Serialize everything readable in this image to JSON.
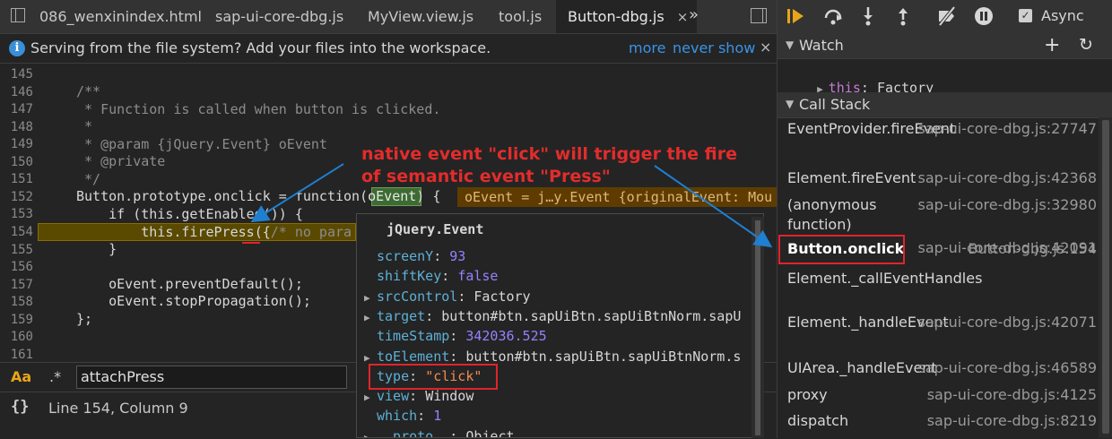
{
  "tabs": [
    {
      "label": "086_wenxinindex.html",
      "active": false,
      "closable": false
    },
    {
      "label": "sap-ui-core-dbg.js",
      "active": false,
      "closable": false
    },
    {
      "label": "MyView.view.js",
      "active": false,
      "closable": false
    },
    {
      "label": "tool.js",
      "active": false,
      "closable": false
    },
    {
      "label": "Button-dbg.js",
      "active": true,
      "closable": true
    }
  ],
  "tab_overflow": "»",
  "tab_close_glyph": "×",
  "info_bar": {
    "message": "Serving from the file system? Add your files into the workspace.",
    "link_more": "more",
    "link_never": "never show",
    "close": "×",
    "icon": "i"
  },
  "code": {
    "line_numbers": [
      "145",
      "146",
      "147",
      "148",
      "149",
      "150",
      "151",
      "152",
      "153",
      "154",
      "155",
      "156",
      "157",
      "158",
      "159",
      "160",
      "161"
    ],
    "line_146": "/**",
    "line_147": " * Function is called when button is clicked.",
    "line_148": " *",
    "line_149": " * @param {jQuery.Event} oEvent",
    "line_150": " * @private",
    "line_151": " */",
    "line_152_a": "Button.prototype.onclick = function(",
    "line_152_param": "oEvent",
    "line_152_b": ") {",
    "line_152_inline": "oEvent = j…y.Event {originalEvent: Mou",
    "line_153": "    if (this.getEnabled()) {",
    "line_154_a": "        this.",
    "line_154_fn": "firePress",
    "line_154_b": "({",
    "line_154_cmt": "/* no para",
    "line_155": "    }",
    "line_157": "    oEvent.preventDefault();",
    "line_158": "    oEvent.stopPropagation();",
    "line_159": "};"
  },
  "search": {
    "case_label": "Aa",
    "regex_label": ".*",
    "value": "attachPress"
  },
  "status": {
    "braces": "{}",
    "position": "Line 154, Column 9"
  },
  "popover": {
    "title": "jQuery.Event",
    "rows": [
      {
        "expand": "",
        "key": "screenY",
        "sep": ": ",
        "value": "93",
        "kind": "num"
      },
      {
        "expand": "",
        "key": "shiftKey",
        "sep": ": ",
        "value": "false",
        "kind": "kw"
      },
      {
        "expand": "▶",
        "key": "srcControl",
        "sep": ": ",
        "value": "Factory",
        "kind": "obj"
      },
      {
        "expand": "▶",
        "key": "target",
        "sep": ": ",
        "value": "button#btn.sapUiBtn.sapUiBtnNorm.sapU",
        "kind": "obj"
      },
      {
        "expand": "",
        "key": "timeStamp",
        "sep": ": ",
        "value": "342036.525",
        "kind": "num"
      },
      {
        "expand": "▶",
        "key": "toElement",
        "sep": ": ",
        "value": "button#btn.sapUiBtn.sapUiBtnNorm.s",
        "kind": "obj"
      },
      {
        "expand": "",
        "key": "type",
        "sep": ": ",
        "value": "\"click\"",
        "kind": "str"
      },
      {
        "expand": "▶",
        "key": "view",
        "sep": ": ",
        "value": "Window",
        "kind": "obj"
      },
      {
        "expand": "",
        "key": "which",
        "sep": ": ",
        "value": "1",
        "kind": "num"
      },
      {
        "expand": "▶",
        "key": "__proto__",
        "sep": ": ",
        "value": "Object",
        "kind": "obj"
      }
    ]
  },
  "annotation": {
    "line1": "native event \"click\" will trigger the fire",
    "line2": "of semantic event \"Press\"",
    "color": "#e32c2c"
  },
  "debugger": {
    "async_label": "Async",
    "async_checked": true,
    "watch_title": "Watch",
    "watch_add": "+",
    "watch_refresh": "↻",
    "watch_key": "this",
    "watch_value": "Factory",
    "call_stack_title": "Call Stack",
    "frames": [
      {
        "name": "EventProvider.fireEvent",
        "location": "sap-ui-core-dbg.js:27747",
        "selected": false
      },
      {
        "name": "Element.fireEvent",
        "location": "sap-ui-core-dbg.js:42368",
        "selected": false
      },
      {
        "name": "(anonymous function)",
        "location": "sap-ui-core-dbg.js:32980",
        "selected": false
      },
      {
        "name": "Button.onclick",
        "location": "Button-dbg.js:154",
        "selected": true
      },
      {
        "name": "Element._callEventHandles",
        "location": "sap-ui-core-dbg.js:42091",
        "selected": false
      },
      {
        "name": "Element._handleEvent",
        "location": "sap-ui-core-dbg.js:42071",
        "selected": false
      },
      {
        "name": "UIArea._handleEvent",
        "location": "sap-ui-core-dbg.js:46589",
        "selected": false
      },
      {
        "name": "proxy",
        "location": "sap-ui-core-dbg.js:4125",
        "selected": false
      },
      {
        "name": "dispatch",
        "location": "sap-ui-core-dbg.js:8219",
        "selected": false
      }
    ]
  },
  "colors": {
    "accent_orange": "#e8a51a",
    "link_blue": "#3a94e6",
    "annotation_red": "#e32c2c"
  }
}
